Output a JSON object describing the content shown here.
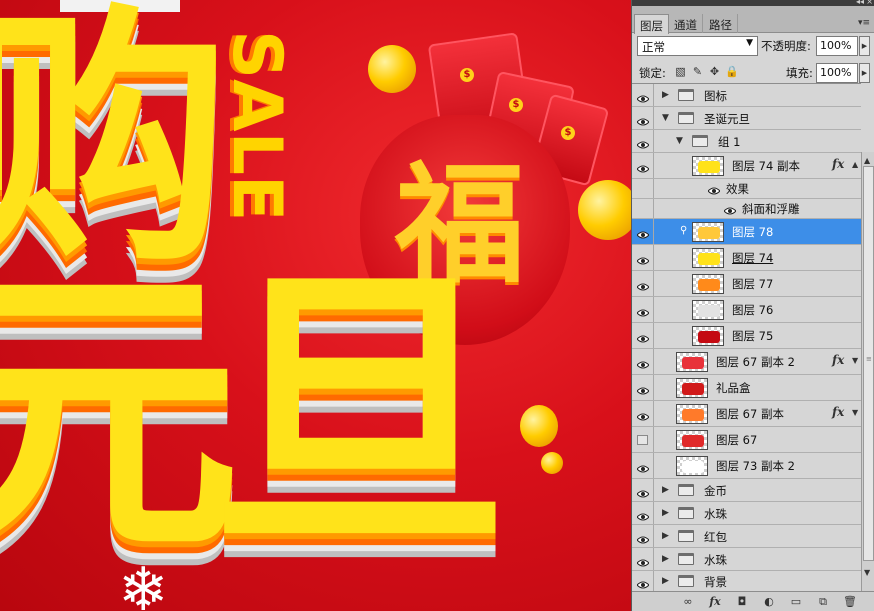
{
  "canvas": {
    "headline_top": "购",
    "headline_bottom": "元旦",
    "sale_text": "SALE",
    "bag_character": "福",
    "envelope_symbol": "$",
    "snowflake_glyph": "❄"
  },
  "panel": {
    "tabs": [
      {
        "label": "图层",
        "active": true
      },
      {
        "label": "通道",
        "active": false
      },
      {
        "label": "路径",
        "active": false
      }
    ],
    "blend_mode": "正常",
    "opacity_label": "不透明度:",
    "opacity_value": "100%",
    "lock_label": "锁定:",
    "fill_label": "填充:",
    "fill_value": "100%"
  },
  "layers": [
    {
      "name": "图标",
      "kind": "group",
      "expanded": false,
      "visible": true
    },
    {
      "name": "圣诞元旦",
      "kind": "group",
      "expanded": true,
      "visible": true
    },
    {
      "name": "组 1",
      "kind": "group",
      "expanded": true,
      "visible": true
    },
    {
      "name": "图层 74 副本",
      "kind": "layer",
      "visible": true,
      "fx": true,
      "thumb_color": "#ffe21a"
    },
    {
      "name": "效果",
      "kind": "effects",
      "visible": true
    },
    {
      "name": "斜面和浮雕",
      "kind": "effect",
      "visible": true
    },
    {
      "name": "图层 78",
      "kind": "layer",
      "visible": true,
      "selected": true,
      "thumb_color": "#ffc83a"
    },
    {
      "name": "图层 74",
      "kind": "layer",
      "visible": true,
      "underline": true,
      "thumb_color": "#ffe21a"
    },
    {
      "name": "图层 77",
      "kind": "layer",
      "visible": true,
      "thumb_color": "#ff8a1a"
    },
    {
      "name": "图层 76",
      "kind": "layer",
      "visible": true,
      "thumb_color": "#e3e3e3"
    },
    {
      "name": "图层 75",
      "kind": "layer",
      "visible": true,
      "thumb_color": "#c40a12"
    },
    {
      "name": "图层 67 副本 2",
      "kind": "layer",
      "visible": true,
      "fx": true,
      "thumb_color": "#e8323a"
    },
    {
      "name": "礼品盒",
      "kind": "layer",
      "visible": true,
      "thumb_color": "#d11a1a"
    },
    {
      "name": "图层 67 副本",
      "kind": "layer",
      "visible": true,
      "fx": true,
      "thumb_color": "#ff7a2a"
    },
    {
      "name": "图层 67",
      "kind": "layer",
      "visible": false,
      "thumb_color": "#e02a2a"
    },
    {
      "name": "图层 73 副本 2",
      "kind": "layer",
      "visible": true,
      "thumb_color": "#ffffff"
    },
    {
      "name": "金币",
      "kind": "group",
      "expanded": false,
      "visible": true
    },
    {
      "name": "水珠",
      "kind": "group",
      "expanded": false,
      "visible": true
    },
    {
      "name": "红包",
      "kind": "group",
      "expanded": false,
      "visible": true
    },
    {
      "name": "水珠",
      "kind": "group",
      "expanded": false,
      "visible": true
    },
    {
      "name": "背景",
      "kind": "group",
      "expanded": false,
      "visible": true
    }
  ],
  "layer_fx_label": "fx",
  "bottom_bar": [
    {
      "name": "link-layers-icon",
      "glyph": "∞"
    },
    {
      "name": "layer-style-icon",
      "glyph": "fx"
    },
    {
      "name": "add-mask-icon",
      "glyph": "◘"
    },
    {
      "name": "adjustment-layer-icon",
      "glyph": "◐"
    },
    {
      "name": "new-group-icon",
      "glyph": "▭"
    },
    {
      "name": "new-layer-icon",
      "glyph": "⧉"
    },
    {
      "name": "delete-layer-icon",
      "glyph": "🗑"
    }
  ],
  "colors": {
    "selection": "#3d8ee8",
    "panel_bg": "#d6d6d6",
    "canvas_red": "#d40a12",
    "headline_yellow": "#ffe31a"
  }
}
